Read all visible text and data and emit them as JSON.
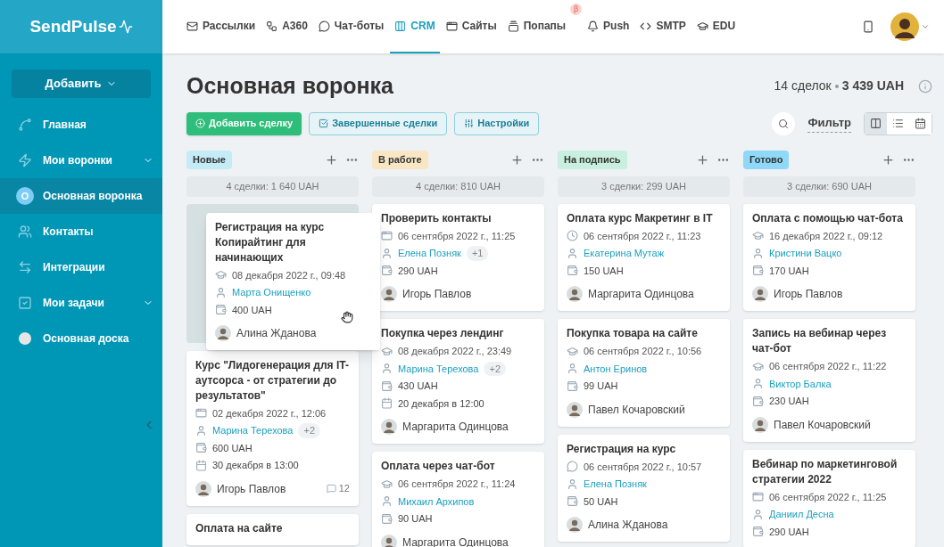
{
  "logo": "SendPulse",
  "nav": [
    {
      "label": "Рассылки",
      "selected": false
    },
    {
      "label": "A360",
      "selected": false
    },
    {
      "label": "Чат-боты",
      "selected": false
    },
    {
      "label": "CRM",
      "selected": true
    },
    {
      "label": "Сайты",
      "selected": false
    },
    {
      "label": "Попапы",
      "selected": false,
      "badge": "β"
    },
    {
      "label": "Push",
      "selected": false
    },
    {
      "label": "SMTP",
      "selected": false
    },
    {
      "label": "EDU",
      "selected": false
    }
  ],
  "sidebar": {
    "add_button": "Добавить",
    "items": [
      {
        "label": "Главная",
        "selected": false,
        "has_caret": false
      },
      {
        "label": "Мои воронки",
        "selected": false,
        "has_caret": true
      },
      {
        "label": "Основная воронка",
        "letter": "О",
        "selected": true,
        "has_caret": false
      },
      {
        "label": "Контакты",
        "selected": false,
        "has_caret": false
      },
      {
        "label": "Интеграции",
        "selected": false,
        "has_caret": false
      },
      {
        "label": "Мои задачи",
        "selected": false,
        "has_caret": true
      },
      {
        "label": "Основная доска",
        "selected": false,
        "has_caret": false
      }
    ]
  },
  "page": {
    "title": "Основная воронка",
    "summary_count": "14 сделок",
    "summary_sum": "3 439 UAH",
    "buttons": [
      {
        "label": "Добавить сделку",
        "kind": "primary"
      },
      {
        "label": "Завершенные сделки",
        "kind": "outline"
      },
      {
        "label": "Настройки",
        "kind": "outline"
      }
    ],
    "filter": "Фильтр",
    "views": [
      {
        "selected": true
      },
      {
        "selected": false
      },
      {
        "selected": false
      }
    ]
  },
  "columns": [
    {
      "name": "Новые",
      "color": "#c4ebf6",
      "total": "4 сделки: 1 640 UAH",
      "dragged_card": {
        "title": "Регистрация на курс Копирайтинг для начинающих",
        "kind": "course",
        "date": "08 декабря 2022 г., 09:48",
        "contact": "Марта Онищенко",
        "amount": "400 UAH",
        "owner": "Алина Жданова"
      },
      "cards": [
        {
          "title": "Курс \"Лидогенерация для IT-аутсорса - от стратегии до результатов\"",
          "kind": "form",
          "date": "02 декабря 2022 г., 12:06",
          "contact": "Марина Терехова",
          "extra": "+2",
          "amount": "600 UAH",
          "due": "30 декабря в 13:00",
          "owner": "Игорь Павлов",
          "comments": "12"
        },
        {
          "title": "Оплата на сайте"
        }
      ]
    },
    {
      "name": "В работе",
      "color": "#f8e6c4",
      "total": "4 сделки: 810 UAH",
      "cards": [
        {
          "title": "Проверить контакты",
          "kind": "form",
          "date": "06 сентября 2022 г., 11:25",
          "contact": "Елена Позняк",
          "extra": "+1",
          "amount": "290 UAH",
          "owner": "Игорь Павлов"
        },
        {
          "title": "Покупка через лендинг",
          "kind": "course",
          "date": "08 декабря 2022 г., 23:49",
          "contact": "Марина Терехова",
          "extra": "+2",
          "amount": "430 UAH",
          "due": "20 декабря в 12:00",
          "owner": "Маргарита Одинцова"
        },
        {
          "title": "Оплата через чат-бот",
          "kind": "course",
          "date": "06 сентября 2022 г., 11:24",
          "contact": "Михаил Архипов",
          "amount": "90 UAH",
          "owner": "Маргарита Одинцова"
        }
      ]
    },
    {
      "name": "На подпись",
      "color": "#c8efdf",
      "total": "3 сделки: 299 UAH",
      "cards": [
        {
          "title": "Оплата курс Макретинг в IT",
          "kind": "timer",
          "date": "06 сентября 2022 г., 11:23",
          "contact": "Екатерина Мутаж",
          "amount": "150 UAH",
          "owner": "Маргарита Одинцова"
        },
        {
          "title": "Покупка товара на сайте",
          "kind": "course",
          "date": "06 сентября 2022 г., 10:56",
          "contact": "Антон Еринов",
          "amount": "99 UAH",
          "owner": "Павел Кочаровский"
        },
        {
          "title": "Регистрация на курс",
          "kind": "chatbot",
          "date": "06 сентября 2022 г., 10:57",
          "contact": "Елена Позняк",
          "amount": "50 UAH",
          "owner": "Алина Жданова"
        }
      ]
    },
    {
      "name": "Готово",
      "color": "#8fd8f7",
      "total": "3 сделки: 690 UAH",
      "cards": [
        {
          "title": "Оплата с помощью чат-бота",
          "kind": "course",
          "date": "16 декабря 2022 г., 09:12",
          "contact": "Кристини Вацко",
          "amount": "170 UAH",
          "owner": "Игорь Павлов"
        },
        {
          "title": "Запись на вебинар через чат-бот",
          "kind": "course",
          "date": "06 сентября 2022 г., 11:22",
          "contact": "Виктор Балка",
          "amount": "230 UAH",
          "owner": "Павел Кочаровский"
        },
        {
          "title": "Вебинар по маркетинговой стратегии 2022",
          "kind": "form",
          "date": "06 сентября 2022 г., 11:25",
          "contact": "Даниил Десна",
          "amount": "290 UAH"
        }
      ]
    }
  ]
}
